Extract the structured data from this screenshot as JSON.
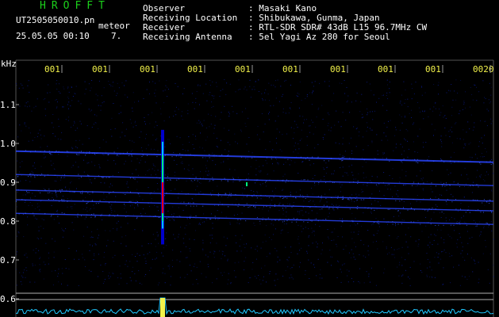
{
  "header": {
    "app_name": "HROFFT",
    "filename": "UT2505050010.pn",
    "event_label": "meteor",
    "datetime": "25.05.05 00:10",
    "count": "7.",
    "colors": {
      "app_name": "#1bd11b",
      "text": "#ffffff",
      "time_labels": "#f2f24a"
    }
  },
  "info": {
    "labels": [
      "Observer",
      "Receiving Location",
      "Receiver",
      "Receiving Antenna"
    ],
    "values": [
      ": Masaki Kano",
      ": Shibukawa, Gunma, Japan",
      ": RTL-SDR SDR# 43dB L15 96.7MHz CW",
      ": 5el Yagi Az 280 for Seoul"
    ]
  },
  "axis": {
    "unit": "kHz",
    "y_ticks": [
      "1.1",
      "1.0",
      "0.9",
      "0.8",
      "0.7",
      "0.6"
    ],
    "time_labels": [
      "001",
      "001",
      "001",
      "001",
      "001",
      "001",
      "001",
      "001",
      "001",
      "0020"
    ]
  },
  "spectrogram": {
    "background": "#000000",
    "noise_color": "#0a1a8a",
    "carrier_color": "#2a46ff",
    "echo_colors": [
      "#0000ff",
      "#00c0ff",
      "#00ff80",
      "#ff0000"
    ],
    "tone_levels_khz": [
      0.98,
      0.92,
      0.88,
      0.855,
      0.82
    ],
    "meteor_range_khz": [
      0.74,
      1.035
    ]
  }
}
